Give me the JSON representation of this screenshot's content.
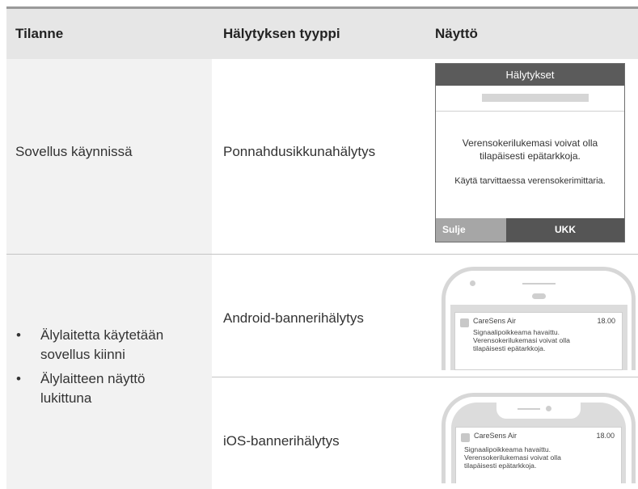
{
  "header": {
    "col1": "Tilanne",
    "col2": "Hälytyksen tyyppi",
    "col3": "Näyttö"
  },
  "row1": {
    "situation": "Sovellus käynnissä",
    "alert_type": "Ponnahdusikkunahälytys",
    "popup": {
      "title": "Hälytykset",
      "message_line1": "Verensokerilukemasi voivat olla",
      "message_line2": "tilapäisesti epätarkkoja.",
      "hint": "Käytä tarvittaessa verensokerimittaria.",
      "close_label": "Sulje",
      "faq_label": "UKK"
    }
  },
  "row2": {
    "situations": [
      "Älylaitetta käytetään sovellus kiinni",
      "Älylaitteen näyttö lukittuna"
    ],
    "android": {
      "alert_type": "Android-bannerihälytys",
      "app": "CareSens Air",
      "time": "18.00",
      "line1": "Signaalipoikkeama havaittu.",
      "line2": "Verensokerilukemasi voivat olla",
      "line3": "tilapäisesti epätarkkoja."
    },
    "ios": {
      "alert_type": "iOS-bannerihälytys",
      "app": "CareSens Air",
      "time": "18.00",
      "line1": "Signaalipoikkeama havaittu.",
      "line2": "Verensokerilukemasi voivat olla",
      "line3": "tilapäisesti epätarkkoja."
    }
  },
  "colors": {
    "header_bg": "#e6e6e6",
    "column1_bg": "#f2f2f2",
    "popup_title_bg": "#5b5b5b",
    "button_light": "#a6a6a6",
    "button_dark": "#555555"
  }
}
